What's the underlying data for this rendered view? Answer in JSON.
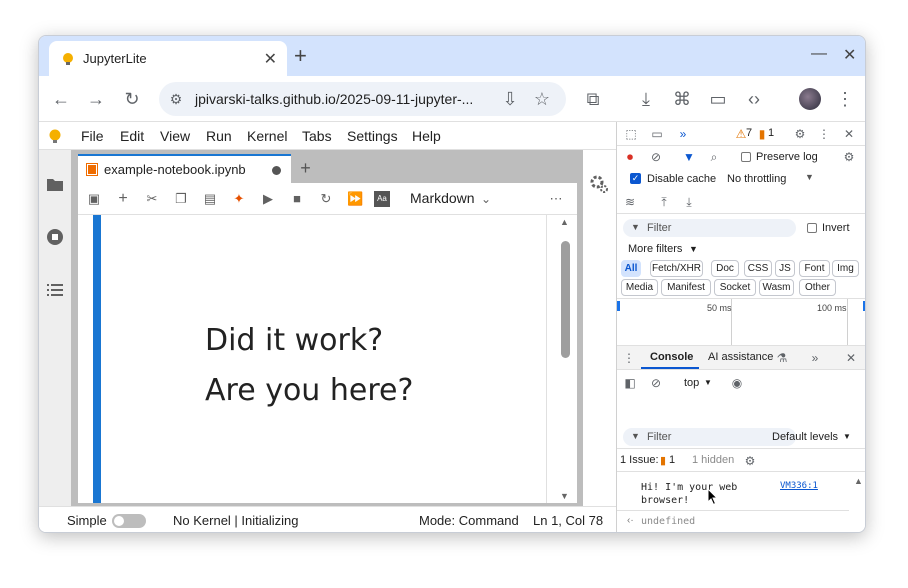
{
  "browser": {
    "tab_title": "JupyterLite",
    "url": "jpivarski-talks.github.io/2025-09-11-jupyter-..."
  },
  "jupyter": {
    "menu": [
      "File",
      "Edit",
      "View",
      "Run",
      "Kernel",
      "Tabs",
      "Settings",
      "Help"
    ],
    "notebook_tab": "example-notebook.ipynb",
    "cell_type": "Markdown",
    "cell_lines": [
      "Did it work?",
      "Are you here?"
    ],
    "status": {
      "simple_label": "Simple",
      "kernel": "No Kernel | Initializing",
      "mode": "Mode: Command",
      "position": "Ln 1, Col 78"
    }
  },
  "devtools": {
    "warnings_count": "7",
    "issues_count": "1",
    "preserve_log": "Preserve log",
    "disable_cache": "Disable cache",
    "throttling": "No throttling",
    "filter_placeholder": "Filter",
    "invert": "Invert",
    "more_filters": "More filters",
    "chips_row1": [
      "All",
      "Fetch/XHR",
      "Doc",
      "CSS",
      "JS",
      "Font",
      "Img"
    ],
    "chips_row2": [
      "Media",
      "Manifest",
      "Socket",
      "Wasm",
      "Other"
    ],
    "timeline": [
      "50 ms",
      "100 ms"
    ],
    "drawer_tabs": [
      "Console",
      "AI assistance"
    ],
    "context": "top",
    "console_filter": "Filter",
    "levels": "Default levels",
    "issue_label": "1 Issue:",
    "issue_badge": "1",
    "hidden": "1 hidden",
    "log_message": "Hi! I'm your web browser!",
    "log_message_line1": "Hi! I'm your web",
    "log_message_line2": "browser!",
    "log_source": "VM336:1",
    "return_value": "undefined"
  },
  "colors": {
    "tabstrip": "#d3e3fd",
    "jupyter_accent": "#1976d2",
    "devtools_accent": "#0b57d0"
  }
}
